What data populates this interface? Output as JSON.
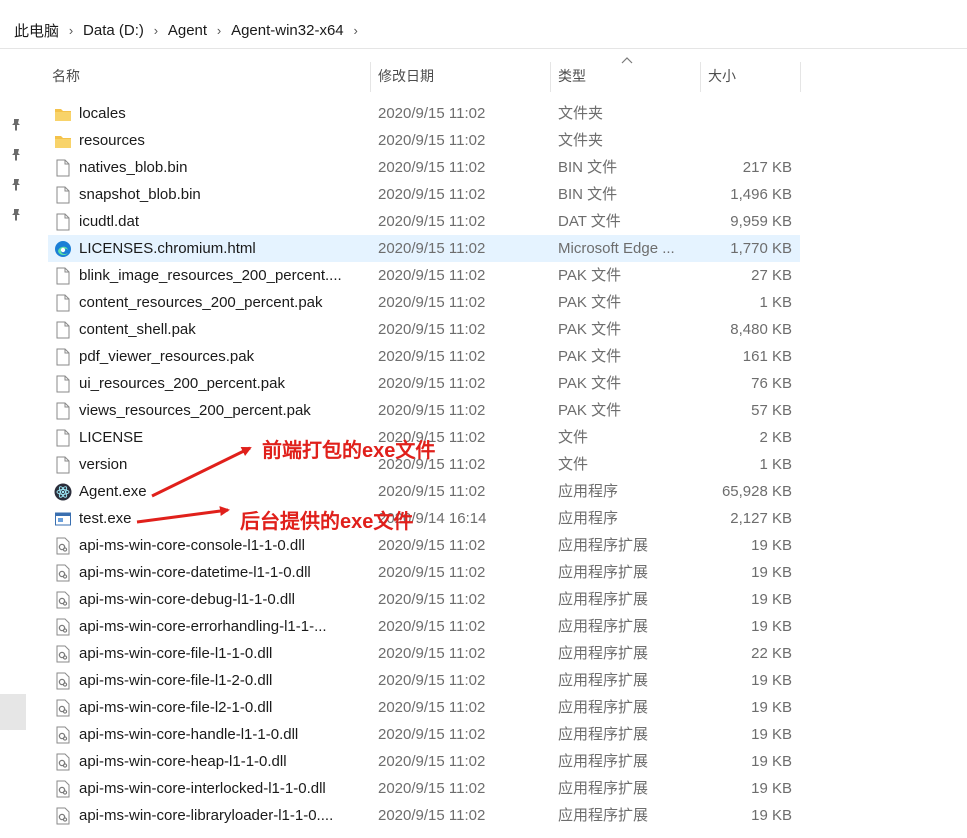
{
  "breadcrumb": {
    "items": [
      "此电脑",
      "Data (D:)",
      "Agent",
      "Agent-win32-x64"
    ]
  },
  "columns": {
    "name": "名称",
    "date": "修改日期",
    "type": "类型",
    "size": "大小"
  },
  "files": [
    {
      "name": "locales",
      "date": "2020/9/15 11:02",
      "type": "文件夹",
      "size": "",
      "icon": "folder-icon"
    },
    {
      "name": "resources",
      "date": "2020/9/15 11:02",
      "type": "文件夹",
      "size": "",
      "icon": "folder-icon"
    },
    {
      "name": "natives_blob.bin",
      "date": "2020/9/15 11:02",
      "type": "BIN 文件",
      "size": "217 KB",
      "icon": "file-icon"
    },
    {
      "name": "snapshot_blob.bin",
      "date": "2020/9/15 11:02",
      "type": "BIN 文件",
      "size": "1,496 KB",
      "icon": "file-icon"
    },
    {
      "name": "icudtl.dat",
      "date": "2020/9/15 11:02",
      "type": "DAT 文件",
      "size": "9,959 KB",
      "icon": "file-icon"
    },
    {
      "name": "LICENSES.chromium.html",
      "date": "2020/9/15 11:02",
      "type": "Microsoft Edge ...",
      "size": "1,770 KB",
      "icon": "edge-icon",
      "selected": true
    },
    {
      "name": "blink_image_resources_200_percent....",
      "date": "2020/9/15 11:02",
      "type": "PAK 文件",
      "size": "27 KB",
      "icon": "file-icon"
    },
    {
      "name": "content_resources_200_percent.pak",
      "date": "2020/9/15 11:02",
      "type": "PAK 文件",
      "size": "1 KB",
      "icon": "file-icon"
    },
    {
      "name": "content_shell.pak",
      "date": "2020/9/15 11:02",
      "type": "PAK 文件",
      "size": "8,480 KB",
      "icon": "file-icon"
    },
    {
      "name": "pdf_viewer_resources.pak",
      "date": "2020/9/15 11:02",
      "type": "PAK 文件",
      "size": "161 KB",
      "icon": "file-icon"
    },
    {
      "name": "ui_resources_200_percent.pak",
      "date": "2020/9/15 11:02",
      "type": "PAK 文件",
      "size": "76 KB",
      "icon": "file-icon"
    },
    {
      "name": "views_resources_200_percent.pak",
      "date": "2020/9/15 11:02",
      "type": "PAK 文件",
      "size": "57 KB",
      "icon": "file-icon"
    },
    {
      "name": "LICENSE",
      "date": "2020/9/15 11:02",
      "type": "文件",
      "size": "2 KB",
      "icon": "file-icon"
    },
    {
      "name": "version",
      "date": "2020/9/15 11:02",
      "type": "文件",
      "size": "1 KB",
      "icon": "file-icon"
    },
    {
      "name": "Agent.exe",
      "date": "2020/9/15 11:02",
      "type": "应用程序",
      "size": "65,928 KB",
      "icon": "electron-icon"
    },
    {
      "name": "test.exe",
      "date": "2020/9/14 16:14",
      "type": "应用程序",
      "size": "2,127 KB",
      "icon": "app-window-icon"
    },
    {
      "name": "api-ms-win-core-console-l1-1-0.dll",
      "date": "2020/9/15 11:02",
      "type": "应用程序扩展",
      "size": "19 KB",
      "icon": "dll-icon"
    },
    {
      "name": "api-ms-win-core-datetime-l1-1-0.dll",
      "date": "2020/9/15 11:02",
      "type": "应用程序扩展",
      "size": "19 KB",
      "icon": "dll-icon"
    },
    {
      "name": "api-ms-win-core-debug-l1-1-0.dll",
      "date": "2020/9/15 11:02",
      "type": "应用程序扩展",
      "size": "19 KB",
      "icon": "dll-icon"
    },
    {
      "name": "api-ms-win-core-errorhandling-l1-1-...",
      "date": "2020/9/15 11:02",
      "type": "应用程序扩展",
      "size": "19 KB",
      "icon": "dll-icon"
    },
    {
      "name": "api-ms-win-core-file-l1-1-0.dll",
      "date": "2020/9/15 11:02",
      "type": "应用程序扩展",
      "size": "22 KB",
      "icon": "dll-icon"
    },
    {
      "name": "api-ms-win-core-file-l1-2-0.dll",
      "date": "2020/9/15 11:02",
      "type": "应用程序扩展",
      "size": "19 KB",
      "icon": "dll-icon"
    },
    {
      "name": "api-ms-win-core-file-l2-1-0.dll",
      "date": "2020/9/15 11:02",
      "type": "应用程序扩展",
      "size": "19 KB",
      "icon": "dll-icon"
    },
    {
      "name": "api-ms-win-core-handle-l1-1-0.dll",
      "date": "2020/9/15 11:02",
      "type": "应用程序扩展",
      "size": "19 KB",
      "icon": "dll-icon"
    },
    {
      "name": "api-ms-win-core-heap-l1-1-0.dll",
      "date": "2020/9/15 11:02",
      "type": "应用程序扩展",
      "size": "19 KB",
      "icon": "dll-icon"
    },
    {
      "name": "api-ms-win-core-interlocked-l1-1-0.dll",
      "date": "2020/9/15 11:02",
      "type": "应用程序扩展",
      "size": "19 KB",
      "icon": "dll-icon"
    },
    {
      "name": "api-ms-win-core-libraryloader-l1-1-0....",
      "date": "2020/9/15 11:02",
      "type": "应用程序扩展",
      "size": "19 KB",
      "icon": "dll-icon"
    }
  ],
  "annotations": {
    "frontend": "前端打包的exe文件",
    "backend": "后台提供的exe文件",
    "color": "#e0201b"
  },
  "colors": {
    "selected_row": "#e5f3ff",
    "folder": "#f4c24a"
  }
}
